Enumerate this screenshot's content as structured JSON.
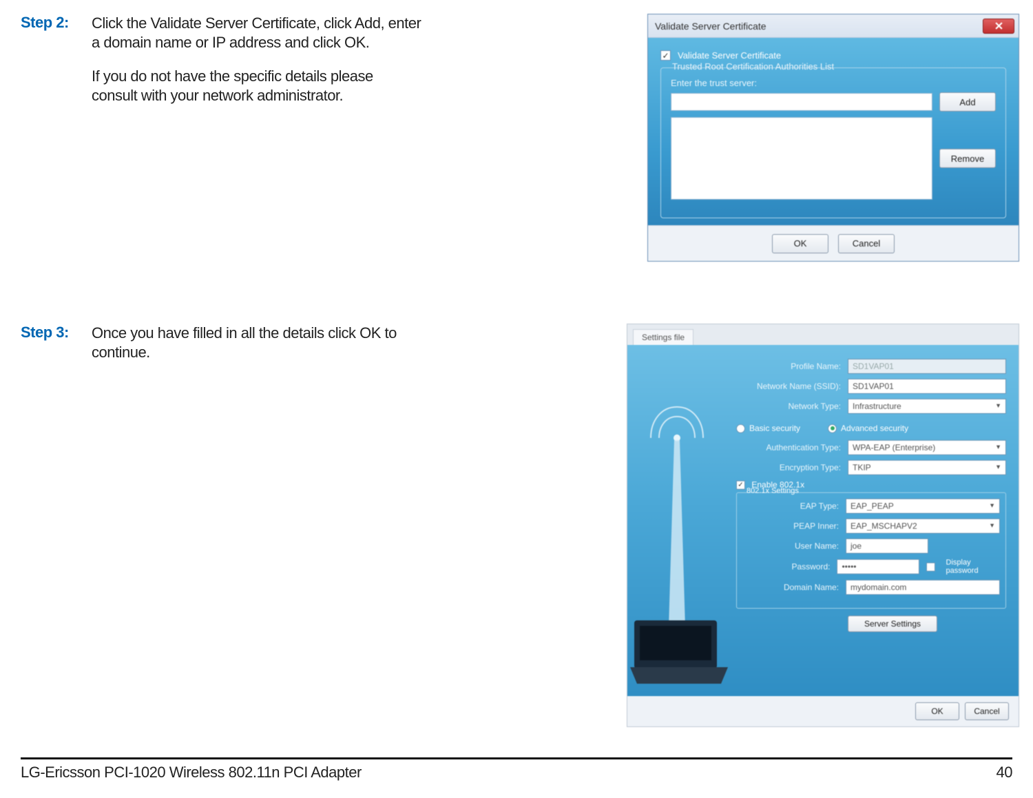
{
  "steps": {
    "s2_label": "Step 2:",
    "s2_p1": "Click the Validate Server Certificate, click Add, enter a domain name or IP address and click OK.",
    "s2_p2": "If you do not have the specific details please consult with your network administrator.",
    "s3_label": "Step 3:",
    "s3_p1": "Once you have filled in all the details click OK to continue."
  },
  "dialog1": {
    "title": "Validate Server Certificate",
    "checkbox_label": "Validate Server Certificate",
    "group_title": "Trusted Root Certification Authorities List",
    "enter_label": "Enter the trust server:",
    "add_btn": "Add",
    "remove_btn": "Remove",
    "ok_btn": "OK",
    "cancel_btn": "Cancel"
  },
  "dialog2": {
    "tab": "Settings file",
    "labels": {
      "profile_name": "Profile Name:",
      "ssid": "Network Name (SSID):",
      "net_type": "Network Type:",
      "basic_sec": "Basic security",
      "adv_sec": "Advanced security",
      "auth_type": "Authentication Type:",
      "enc_type": "Encryption Type:",
      "enable_8021x": "Enable 802.1x",
      "section_8021x": "802.1x Settings",
      "eap_type": "EAP Type:",
      "peap_inner": "PEAP Inner:",
      "user_name": "User Name:",
      "password": "Password:",
      "display_pw": "Display password",
      "domain": "Domain Name:",
      "server_settings": "Server Settings"
    },
    "values": {
      "profile_name": "SD1VAP01",
      "ssid": "SD1VAP01",
      "net_type": "Infrastructure",
      "auth_type": "WPA-EAP (Enterprise)",
      "enc_type": "TKIP",
      "eap_type": "EAP_PEAP",
      "peap_inner": "EAP_MSCHAPV2",
      "user_name": "joe",
      "password": "•••••",
      "domain": "mydomain.com"
    },
    "ok_btn": "OK",
    "cancel_btn": "Cancel"
  },
  "footer": {
    "product": "LG-Ericsson PCI-1020 Wireless 802.11n PCI Adapter",
    "page_no": "40"
  }
}
